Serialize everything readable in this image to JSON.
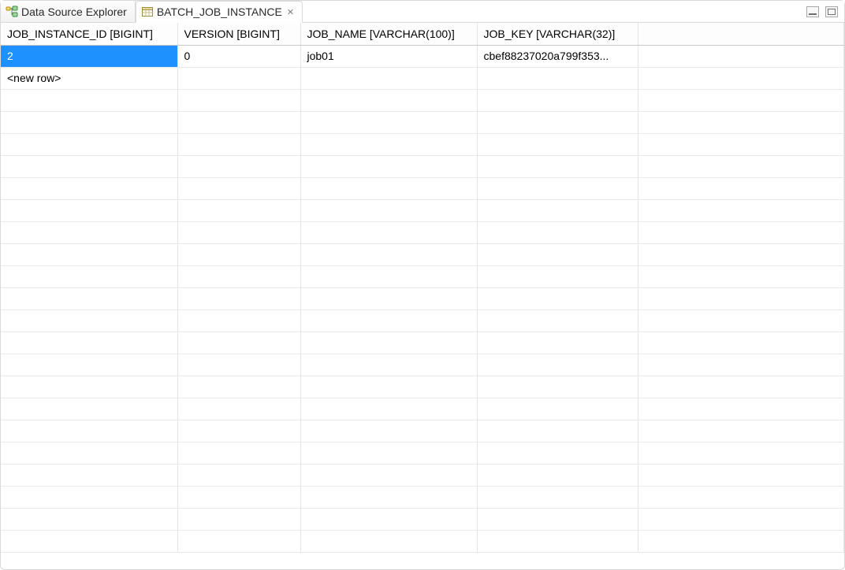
{
  "tabs": {
    "data_source_explorer": {
      "label": "Data Source Explorer"
    },
    "batch_job_instance": {
      "label": "BATCH_JOB_INSTANCE"
    }
  },
  "columns": {
    "c0": "JOB_INSTANCE_ID [BIGINT]",
    "c1": "VERSION [BIGINT]",
    "c2": "JOB_NAME [VARCHAR(100)]",
    "c3": "JOB_KEY [VARCHAR(32)]"
  },
  "rows": [
    {
      "c0": "2",
      "c1": "0",
      "c2": "job01",
      "c3": "cbef88237020a799f353..."
    }
  ],
  "new_row_label": "<new row>",
  "empty_row_count": 21
}
